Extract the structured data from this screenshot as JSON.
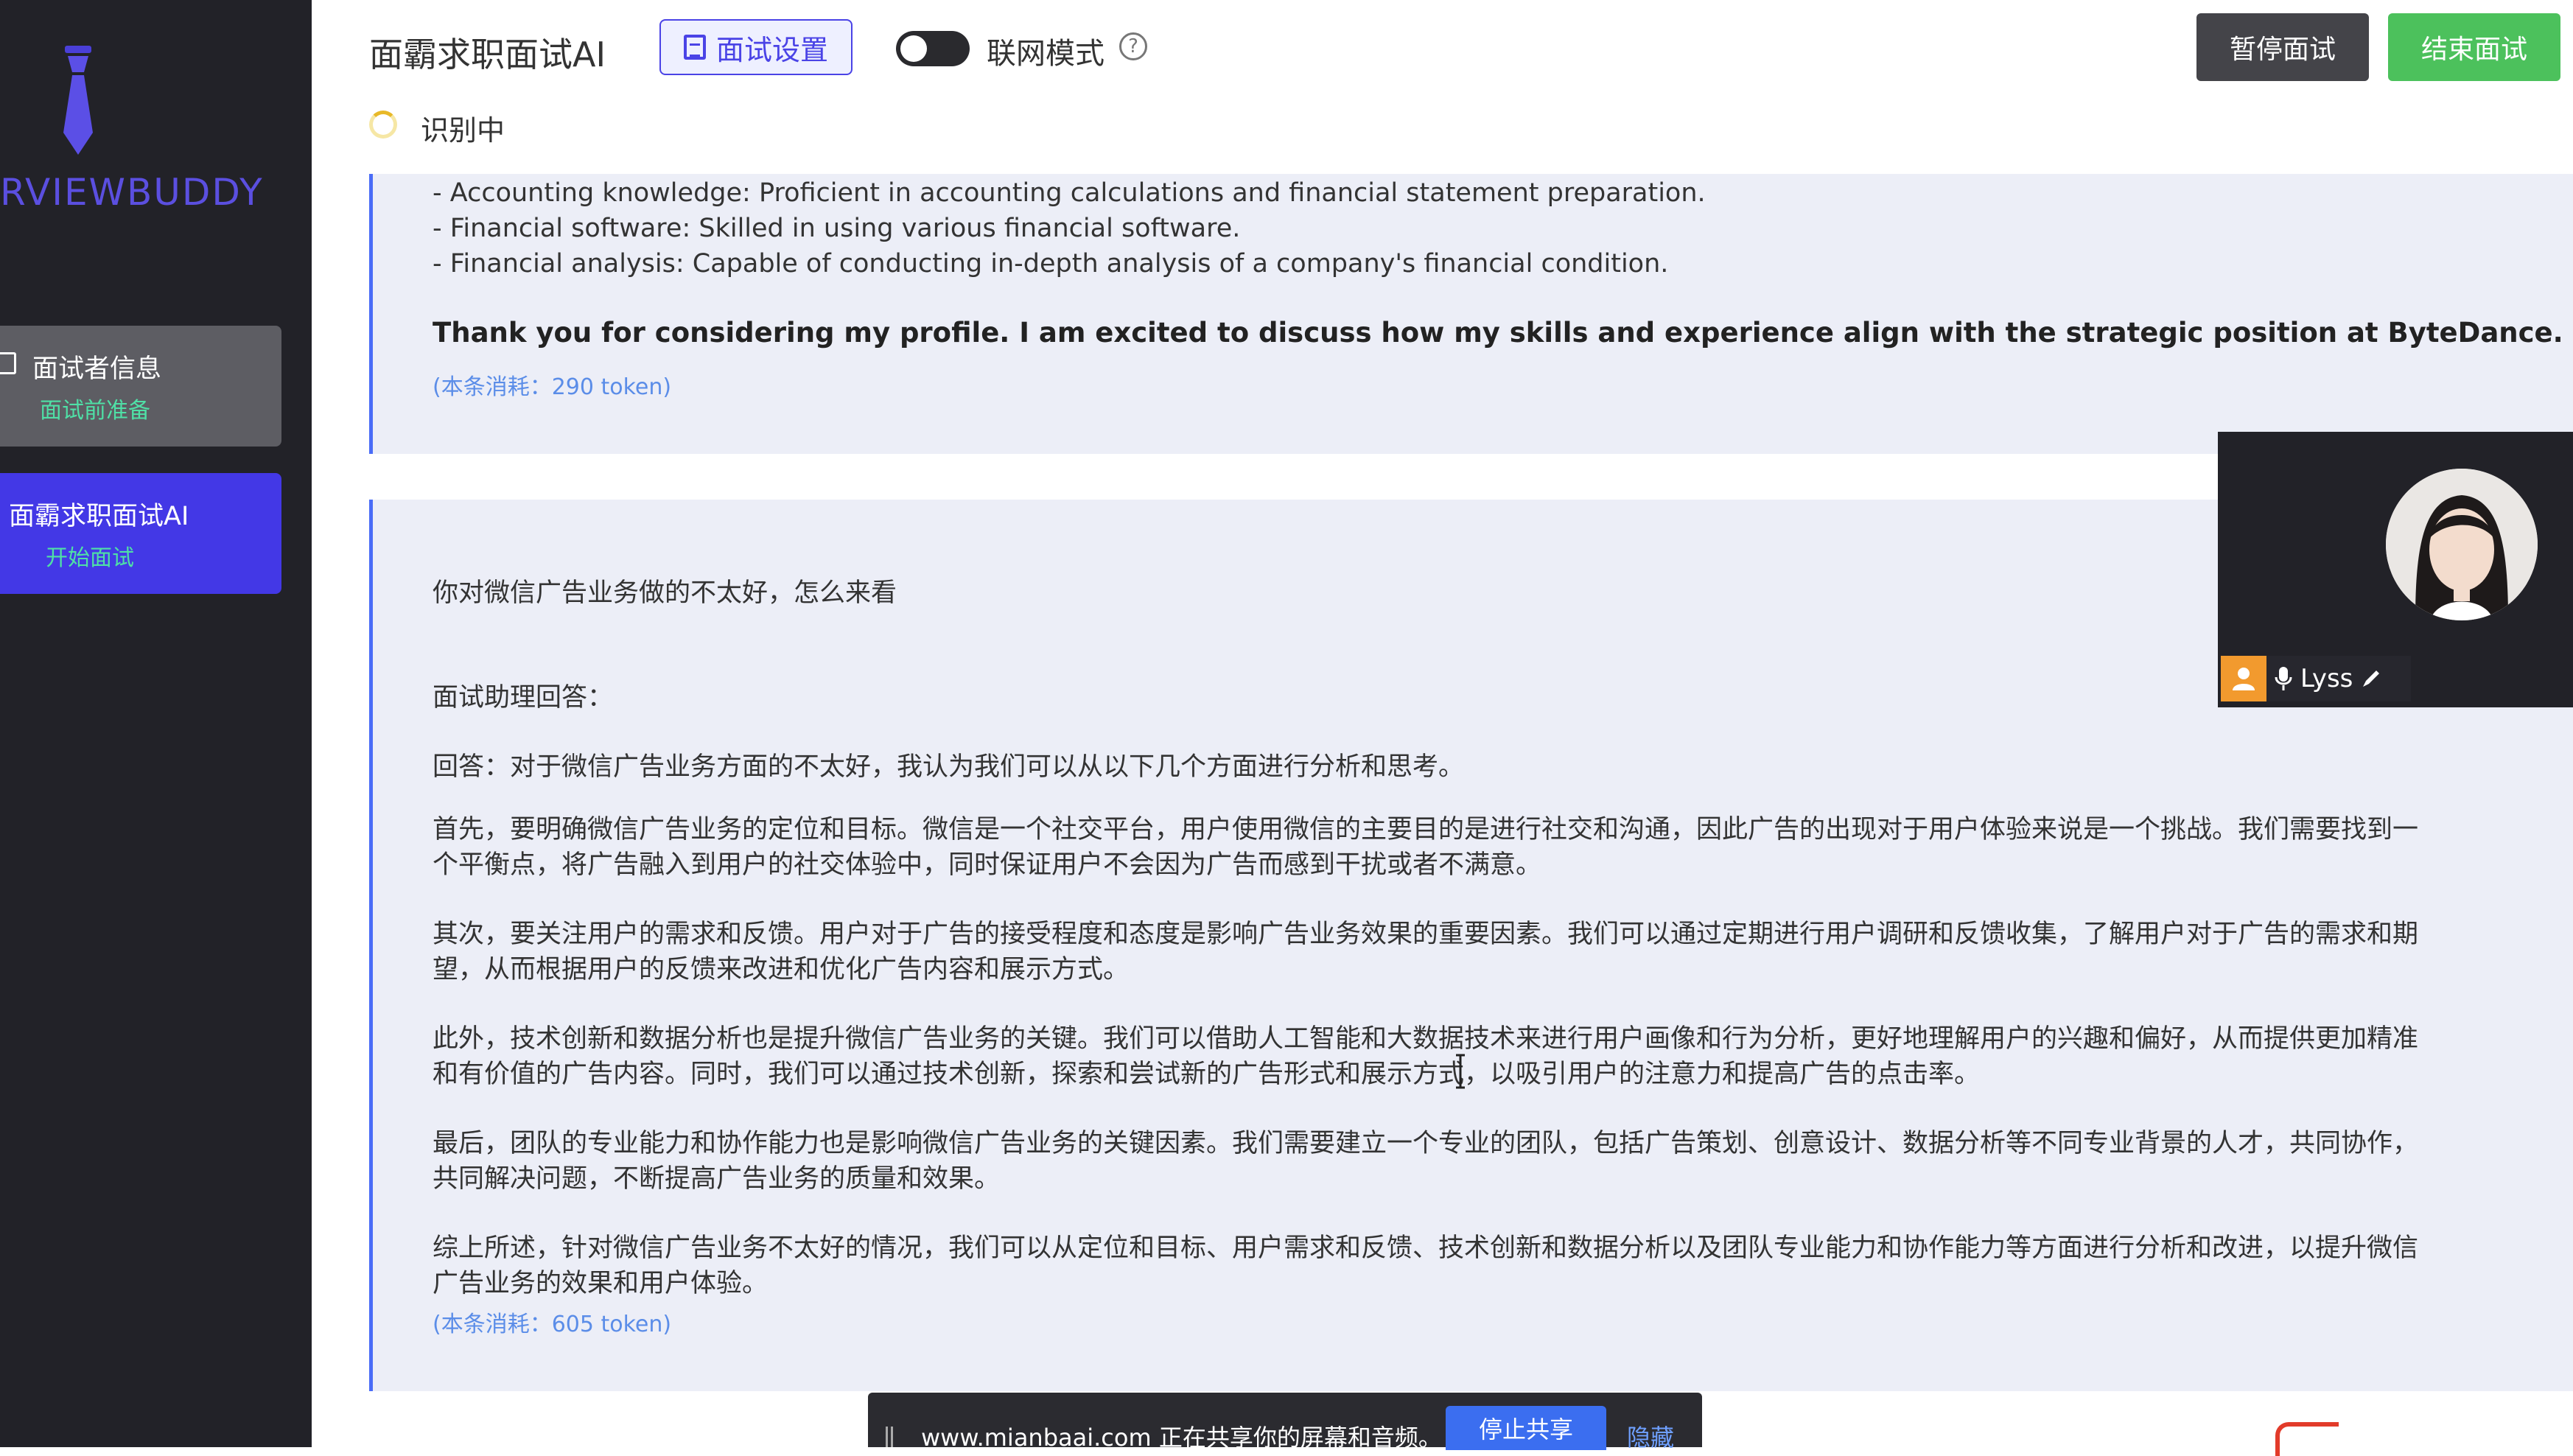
{
  "sidebar": {
    "logo_text": "RVIEWBUDDY",
    "items": [
      {
        "label": "面试者信息",
        "sub": "面试前准备"
      },
      {
        "label": "面霸求职面试AI",
        "sub": "开始面试"
      }
    ]
  },
  "header": {
    "app_title": "面霸求职面试AI",
    "settings_label": "面试设置",
    "network_label": "联网模式",
    "help_icon": "?",
    "pause_label": "暂停面试",
    "end_label": "结束面试",
    "status": "识别中"
  },
  "messages": [
    {
      "lines": [
        "- Accounting knowledge: Proficient in accounting calculations and financial statement preparation.",
        "- Financial software: Skilled in using various financial software.",
        "- Financial analysis: Capable of conducting in-depth analysis of a company's financial condition."
      ],
      "closing": "Thank you for considering my profile. I am excited to discuss how my skills and experience align with the strategic position at ByteDance.",
      "token": "(本条消耗：290 token)"
    },
    {
      "question": "你对微信广告业务做的不太好，怎么来看",
      "answer_header": "面试助理回答：",
      "answer_intro": "回答：对于微信广告业务方面的不太好，我认为我们可以从以下几个方面进行分析和思考。",
      "paragraphs": [
        "首先，要明确微信广告业务的定位和目标。微信是一个社交平台，用户使用微信的主要目的是进行社交和沟通，因此广告的出现对于用户体验来说是一个挑战。我们需要找到一个平衡点，将广告融入到用户的社交体验中，同时保证用户不会因为广告而感到干扰或者不满意。",
        "其次，要关注用户的需求和反馈。用户对于广告的接受程度和态度是影响广告业务效果的重要因素。我们可以通过定期进行用户调研和反馈收集，了解用户对于广告的需求和期望，从而根据用户的反馈来改进和优化广告内容和展示方式。",
        "此外，技术创新和数据分析也是提升微信广告业务的关键。我们可以借助人工智能和大数据技术来进行用户画像和行为分析，更好地理解用户的兴趣和偏好，从而提供更加精准和有价值的广告内容。同时，我们可以通过技术创新，探索和尝试新的广告形式和展示方式，以吸引用户的注意力和提高广告的点击率。",
        "最后，团队的专业能力和协作能力也是影响微信广告业务的关键因素。我们需要建立一个专业的团队，包括广告策划、创意设计、数据分析等不同专业背景的人才，共同协作，共同解决问题，不断提高广告业务的质量和效果。",
        "综上所述，针对微信广告业务不太好的情况，我们可以从定位和目标、用户需求和反馈、技术创新和数据分析以及团队专业能力和协作能力等方面进行分析和改进，以提升微信广告业务的效果和用户体验。"
      ],
      "token": "(本条消耗：605 token)"
    }
  ],
  "video": {
    "user_name": "Lyss"
  },
  "share_bar": {
    "text": "www.mianbaai.com 正在共享你的屏幕和音频。",
    "stop_label": "停止共享",
    "hide_label": "隐藏"
  },
  "colors": {
    "sidebar_bg": "#222228",
    "accent": "#4a43e6",
    "active_nav": "#4338e6",
    "end_button": "#4cc15c",
    "pause_button": "#444449",
    "token_text": "#5b8de8",
    "message_bg": "#eceef7",
    "message_border": "#4a6cf7"
  },
  "icons": [
    "tie-logo-icon",
    "clipboard-icon",
    "help-icon",
    "spinner-icon",
    "user-icon",
    "microphone-icon",
    "pencil-icon",
    "text-cursor-icon"
  ]
}
